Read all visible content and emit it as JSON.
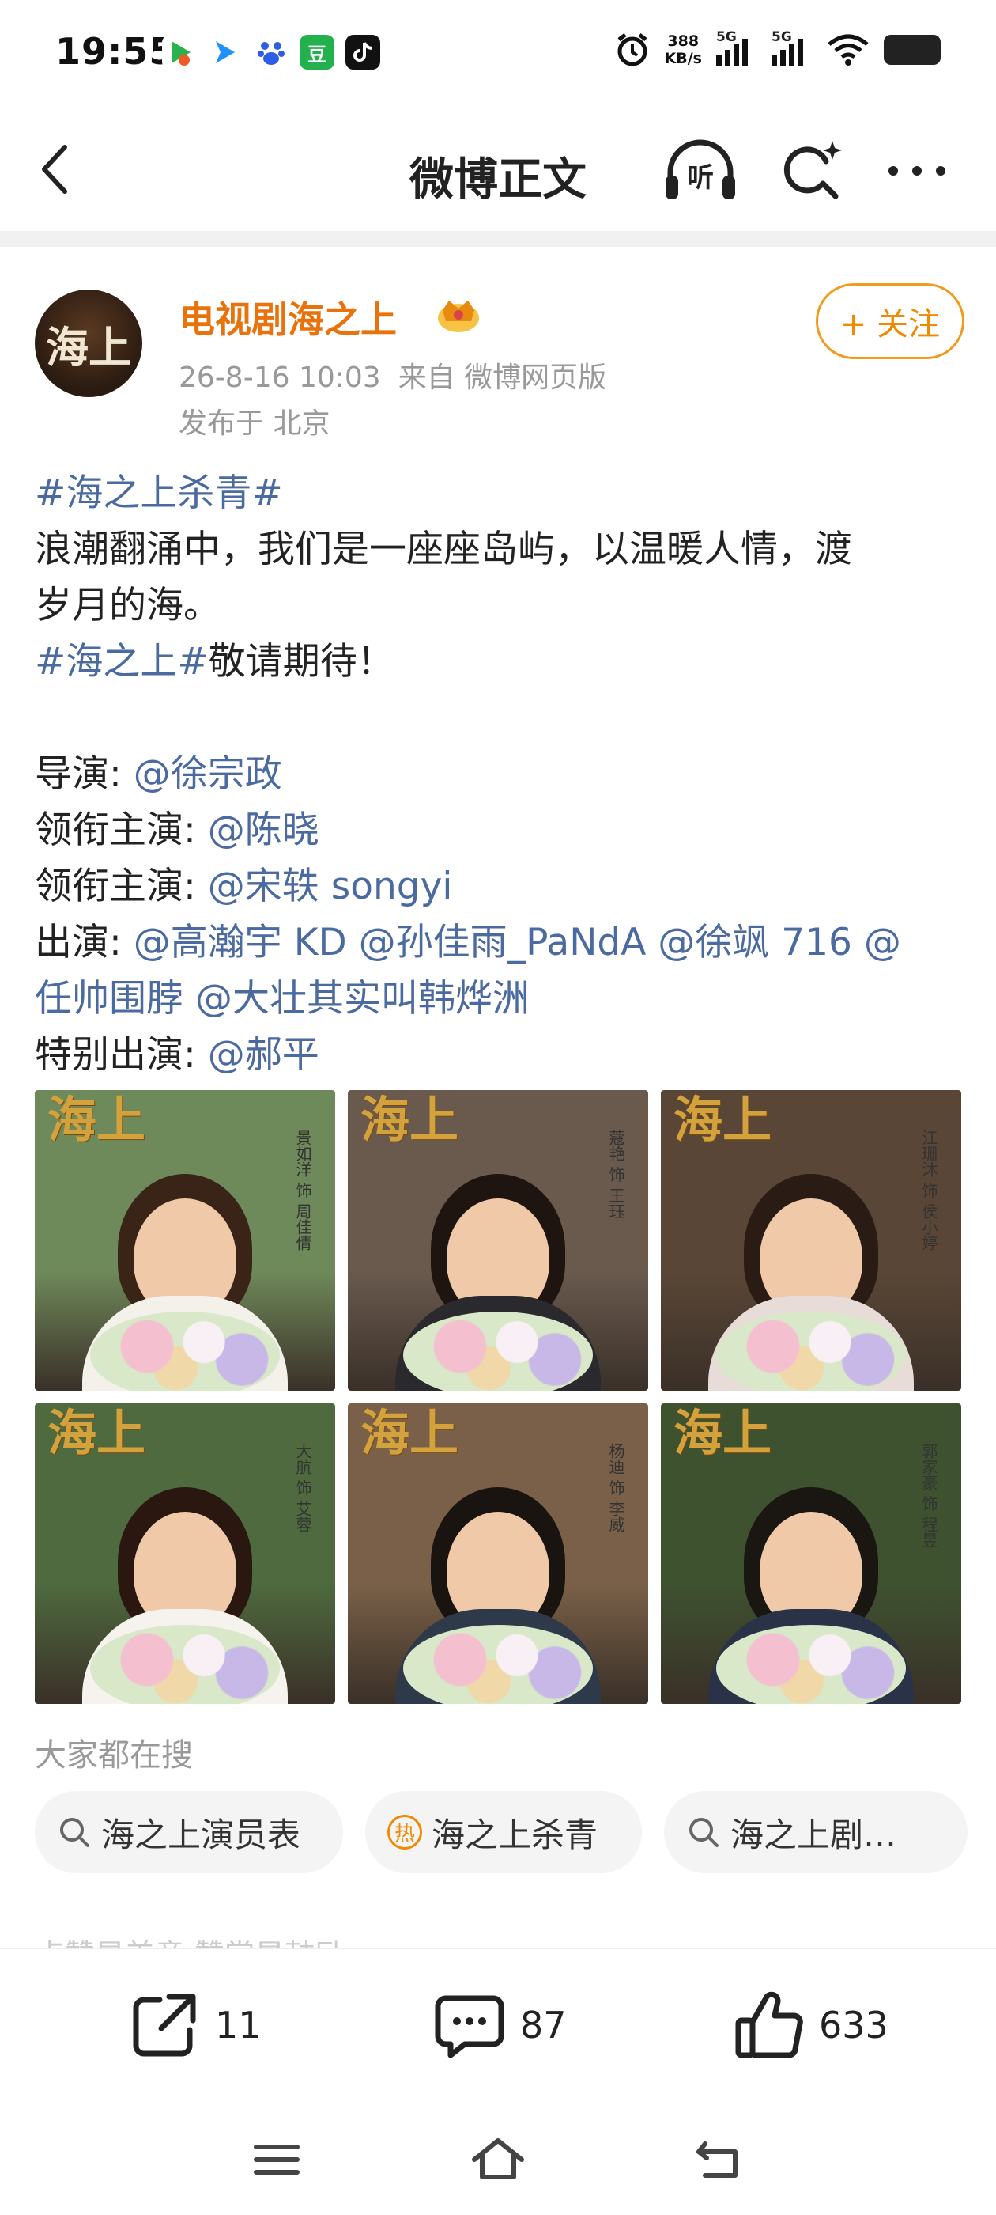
{
  "status_bar": {
    "time": "19:55",
    "net_speed_value": "388",
    "net_speed_unit": "KB/s",
    "signal1_label": "5G",
    "signal2_label": "5G",
    "app_icons": [
      "video-app-icon",
      "arrow-app-icon",
      "baidu-paw-icon",
      "douban-icon",
      "tiktok-icon"
    ],
    "douban_label": "豆"
  },
  "nav": {
    "title": "微博正文",
    "listen_label": "听"
  },
  "post": {
    "author": "电视剧海之上",
    "avatar_text": "海上",
    "time": "26-8-16 10:03",
    "source": "来自 微博网页版",
    "location": "发布于 北京",
    "follow_label": "+ 关注",
    "topic1": "#海之上杀青#",
    "text_line1": "浪潮翻涌中，我们是一座座岛屿，以温暖人情，渡",
    "text_line2": "岁月的海。",
    "topic2": "#海之上#",
    "text_after_topic2": "敬请期待！",
    "director_label": "导演: ",
    "director": "@徐宗政",
    "lead1_label": "领衔主演: ",
    "lead1": "@陈晓",
    "lead2_label": "领衔主演: ",
    "lead2": "@宋轶 songyi",
    "cast_label": "出演: ",
    "cast_line1": "@高瀚宇 KD @孙佳雨_PaNdA @徐飒 716 @",
    "cast_line2": "任帅围脖 @大壮其实叫韩烨洲",
    "special_label": "特别出演: ",
    "special": "@郝平"
  },
  "photos": [
    {
      "logo": "海上",
      "caption": "景如洋 饰 周佳倩",
      "bg": "#6f8a5a",
      "hair": "#3a2418",
      "cloth": "#f4f0ea"
    },
    {
      "logo": "海上",
      "caption": "蔻艳 饰 王珏",
      "bg": "#6a5a4e",
      "hair": "#1e1410",
      "cloth": "#2a2a2e"
    },
    {
      "logo": "海上",
      "caption": "江珊沐 饰 侯小婷",
      "bg": "#5a4636",
      "hair": "#2a1c14",
      "cloth": "#e8dcd8"
    },
    {
      "logo": "海上",
      "caption": "大航 饰 艾蓉",
      "bg": "#4e6a3e",
      "hair": "#2a1810",
      "cloth": "#f6f2ee"
    },
    {
      "logo": "海上",
      "caption": "杨迪 饰 李威",
      "bg": "#7a6048",
      "hair": "#1a1410",
      "cloth": "#2e3a4a"
    },
    {
      "logo": "海上",
      "caption": "郭家豪 饰 程昱",
      "bg": "#3e5230",
      "hair": "#1a1612",
      "cloth": "#2a3248"
    }
  ],
  "search": {
    "label": "大家都在搜",
    "chips": [
      "海之上演员表",
      "海之上杀青",
      "海之上剧…"
    ],
    "hot_label": "热"
  },
  "peek_text": "点赞是美意  赞赏是鼓励",
  "actions": {
    "repost": "11",
    "comment": "87",
    "like": "633"
  },
  "colors": {
    "accent": "#e8720c",
    "link": "#4a6aa0",
    "muted": "#999999"
  }
}
